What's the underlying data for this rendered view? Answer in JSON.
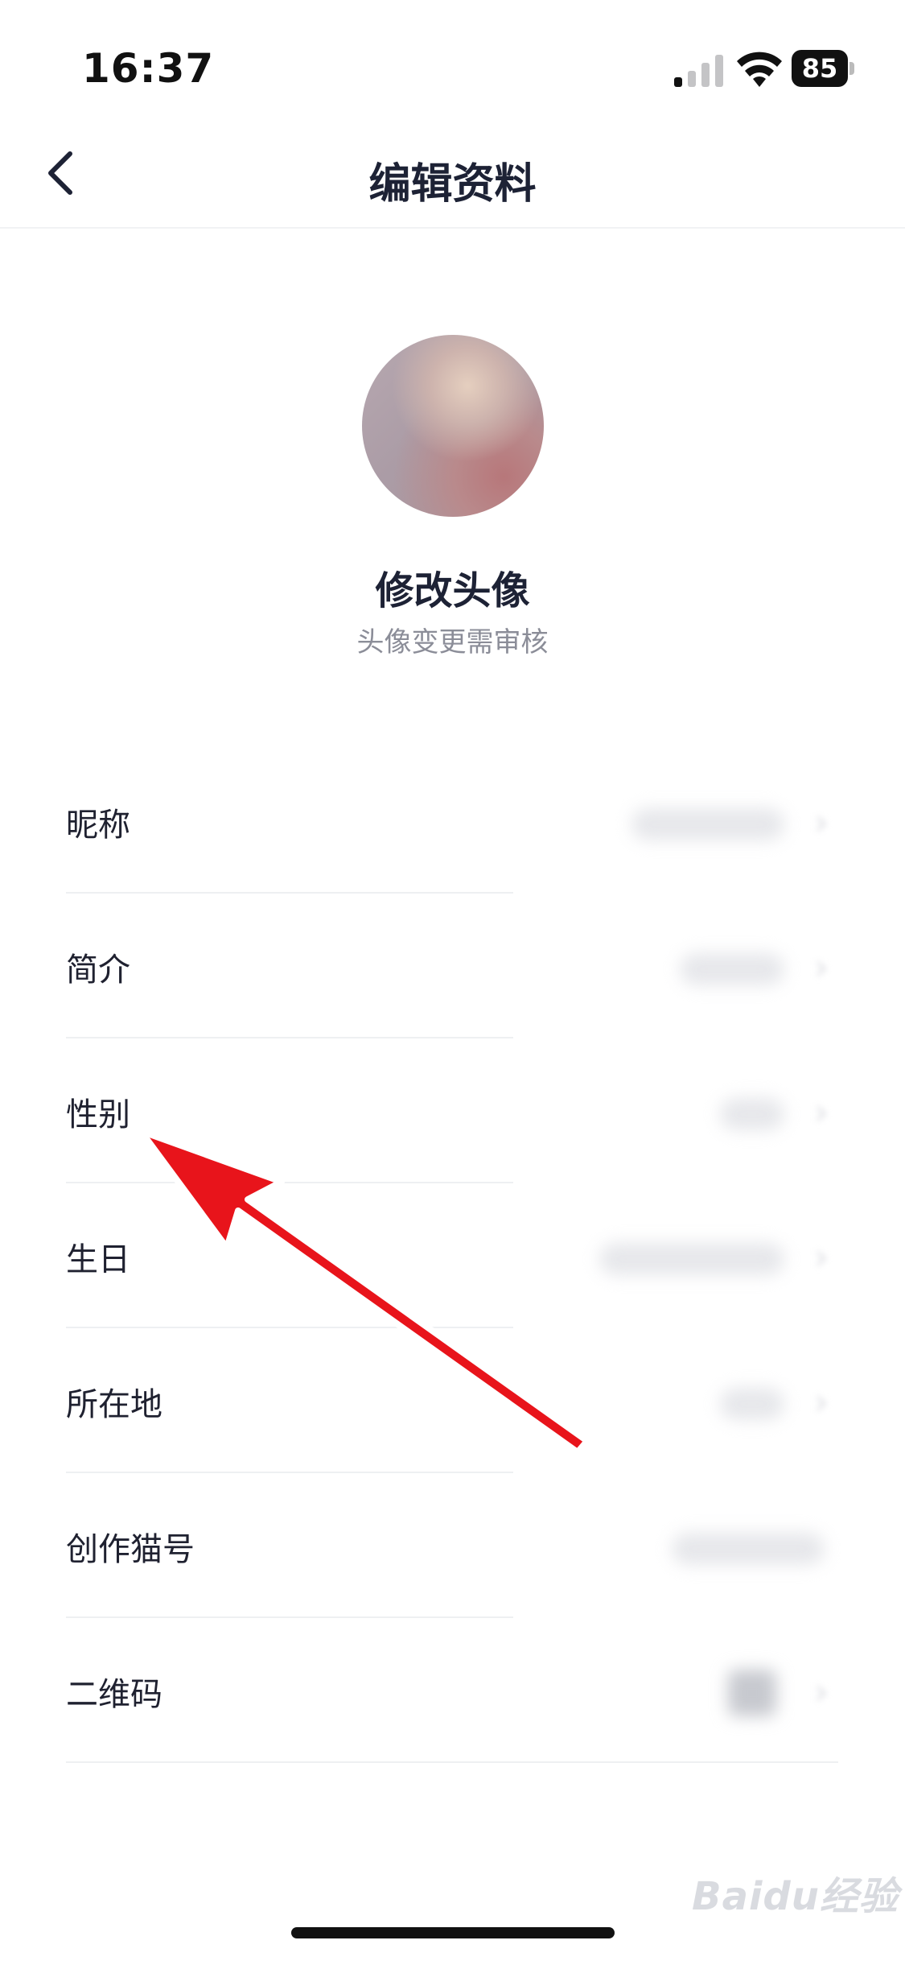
{
  "status_bar": {
    "time": "16:37",
    "battery": "85",
    "icons": [
      "signal-icon",
      "wifi-icon",
      "battery-icon"
    ]
  },
  "nav": {
    "title": "编辑资料",
    "back_icon": "chevron-left-icon"
  },
  "avatar": {
    "title": "修改头像",
    "subtitle": "头像变更需审核"
  },
  "fields": [
    {
      "label": "昵称"
    },
    {
      "label": "简介"
    },
    {
      "label": "性别"
    },
    {
      "label": "生日"
    },
    {
      "label": "所在地"
    },
    {
      "label": "创作猫号"
    },
    {
      "label": "二维码"
    }
  ],
  "annotation": {
    "arrow_color": "#e8141b",
    "points_to": "性别"
  },
  "watermark": {
    "text": "Baidu经验"
  }
}
